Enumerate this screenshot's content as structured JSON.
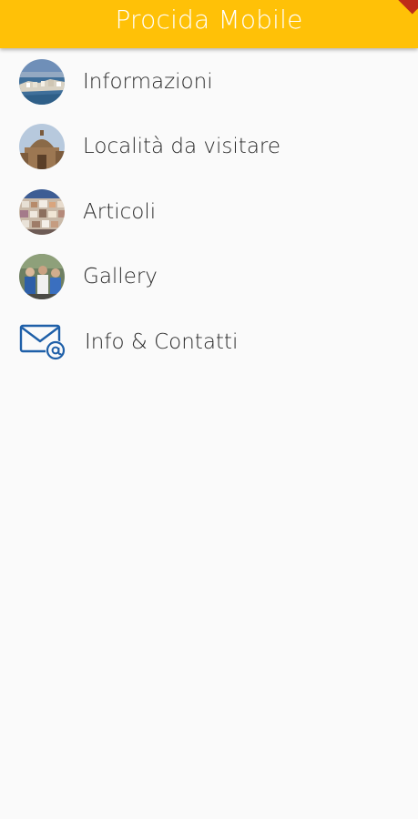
{
  "app_bar": {
    "title": "Procida Mobile",
    "color": "#ffc107"
  },
  "menu": {
    "items": [
      {
        "label": "Informazioni",
        "icon": "harbor-photo-thumbnail"
      },
      {
        "label": "Località da visitare",
        "icon": "church-dome-photo-thumbnail"
      },
      {
        "label": "Articoli",
        "icon": "village-houses-photo-thumbnail"
      },
      {
        "label": "Gallery",
        "icon": "procession-photo-thumbnail"
      },
      {
        "label": "Info & Contatti",
        "icon": "mail-at-icon"
      }
    ]
  },
  "colors": {
    "background": "#fafafa",
    "text": "#2b2b2b",
    "icon_blue": "#1e5fa8"
  }
}
